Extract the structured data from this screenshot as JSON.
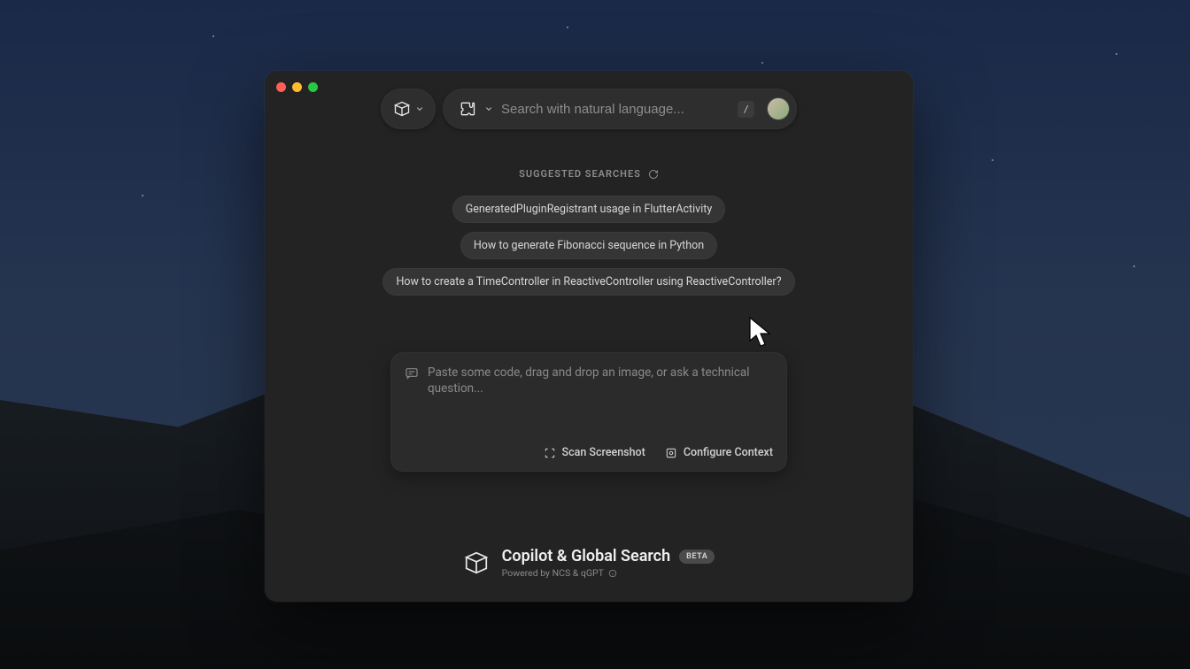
{
  "search": {
    "placeholder": "Search with natural language...",
    "shortcut": "/"
  },
  "suggested": {
    "label": "SUGGESTED SEARCHES",
    "items": [
      "GeneratedPluginRegistrant usage in FlutterActivity",
      "How to generate Fibonacci sequence in Python",
      "How to create a TimeController in ReactiveController using ReactiveController?"
    ]
  },
  "composer": {
    "placeholder": "Paste some code, drag and drop an image, or ask a technical question...",
    "scan_label": "Scan Screenshot",
    "configure_label": "Configure Context"
  },
  "footer": {
    "title": "Copilot & Global Search",
    "badge": "BETA",
    "subtitle": "Powered by NCS & qGPT"
  }
}
